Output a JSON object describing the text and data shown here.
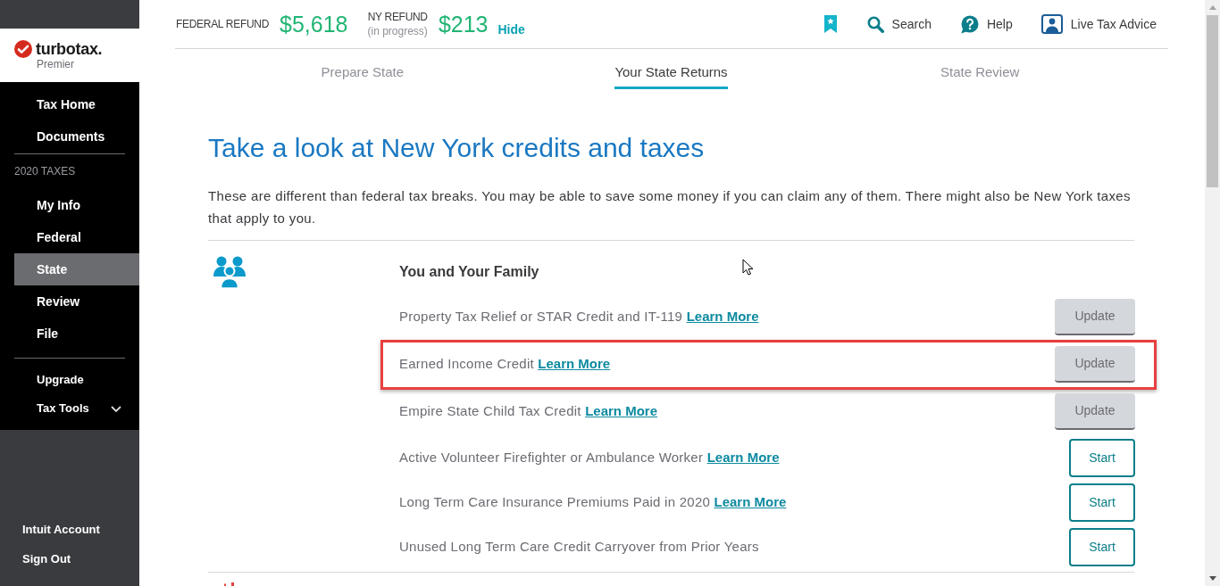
{
  "sidebar": {
    "logo": {
      "brand": "turbotax.",
      "edition": "Premier"
    },
    "nav_primary": [
      {
        "label": "Tax Home",
        "selected": false
      },
      {
        "label": "Documents",
        "selected": false
      }
    ],
    "section_label": "2020 TAXES",
    "nav_taxes": [
      {
        "label": "My Info",
        "selected": false
      },
      {
        "label": "Federal",
        "selected": false
      },
      {
        "label": "State",
        "selected": true
      },
      {
        "label": "Review",
        "selected": false
      },
      {
        "label": "File",
        "selected": false
      }
    ],
    "nav_extra": [
      {
        "label": "Upgrade",
        "kind": "link"
      },
      {
        "label": "Tax Tools",
        "kind": "menu",
        "expanded": false
      }
    ],
    "account_links": [
      {
        "label": "Intuit Account"
      },
      {
        "label": "Sign Out"
      }
    ]
  },
  "header": {
    "refunds": [
      {
        "label": "FEDERAL REFUND",
        "amount": "$5,618"
      },
      {
        "label": "NY REFUND",
        "note": "(in progress)",
        "amount": "$213"
      }
    ],
    "hide_link": "Hide",
    "tools": [
      {
        "kind": "bookmark"
      },
      {
        "kind": "search",
        "label": "Search"
      },
      {
        "kind": "help",
        "label": "Help"
      },
      {
        "kind": "advice",
        "label": "Live Tax Advice"
      }
    ]
  },
  "tabs": [
    {
      "label": "Prepare State",
      "selected": false
    },
    {
      "label": "Your State Returns",
      "selected": true
    },
    {
      "label": "State Review",
      "selected": false
    }
  ],
  "title": "Take a look at New York credits and taxes",
  "intro": "These are different than federal tax breaks. You may be able to save some money if you can claim any of them. There might also be New York taxes that apply to you.",
  "sections": [
    {
      "title": "You and Your Family",
      "items": [
        {
          "label": "Property Tax Relief or STAR Credit and IT-119",
          "link": "Learn More",
          "kind": "update",
          "button": "Update",
          "highlighted": false
        },
        {
          "label": "Earned Income Credit",
          "link": "Learn More",
          "kind": "update",
          "button": "Update",
          "highlighted": true
        },
        {
          "label": "Empire State Child Tax Credit",
          "link": "Learn More",
          "kind": "update",
          "button": "Update",
          "highlighted": false
        },
        {
          "label": "Active Volunteer Firefighter or Ambulance Worker",
          "link": "Learn More",
          "kind": "start",
          "button": "Start",
          "highlighted": false
        },
        {
          "label": "Long Term Care Insurance Premiums Paid in 2020",
          "link": "Learn More",
          "kind": "start",
          "button": "Start",
          "highlighted": false
        },
        {
          "label": "Unused Long Term Care Credit Carryover from Prior Years",
          "kind": "start",
          "button": "Start",
          "highlighted": false
        }
      ]
    }
  ]
}
